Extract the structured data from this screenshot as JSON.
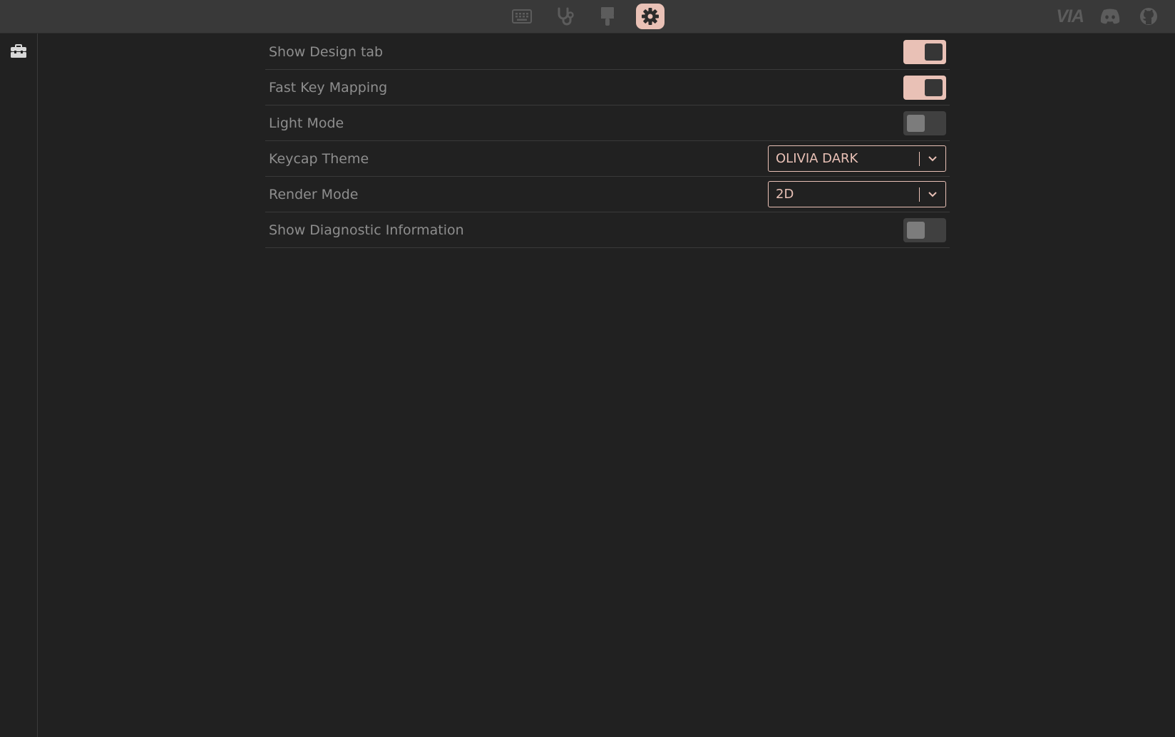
{
  "colors": {
    "accent": "#e9c1b6",
    "topbar": "#393939",
    "background": "#212121",
    "icon_inactive": "#5c5c5c",
    "label": "#8e8e8e"
  },
  "topbar": {
    "tabs": [
      {
        "icon": "keyboard-icon",
        "active": false
      },
      {
        "icon": "stethoscope-icon",
        "active": false
      },
      {
        "icon": "paintbrush-icon",
        "active": false
      },
      {
        "icon": "gear-icon",
        "active": true
      }
    ],
    "brand": "VIA",
    "external": [
      {
        "icon": "discord-icon"
      },
      {
        "icon": "github-icon"
      }
    ]
  },
  "sidebar": {
    "items": [
      {
        "icon": "toolbox-icon"
      }
    ]
  },
  "settings": {
    "show_design_tab": {
      "label": "Show Design tab",
      "enabled": true
    },
    "fast_key_mapping": {
      "label": "Fast Key Mapping",
      "enabled": true
    },
    "light_mode": {
      "label": "Light Mode",
      "enabled": false
    },
    "keycap_theme": {
      "label": "Keycap Theme",
      "value": "OLIVIA DARK"
    },
    "render_mode": {
      "label": "Render Mode",
      "value": "2D"
    },
    "show_diagnostic_information": {
      "label": "Show Diagnostic Information",
      "enabled": false
    }
  }
}
